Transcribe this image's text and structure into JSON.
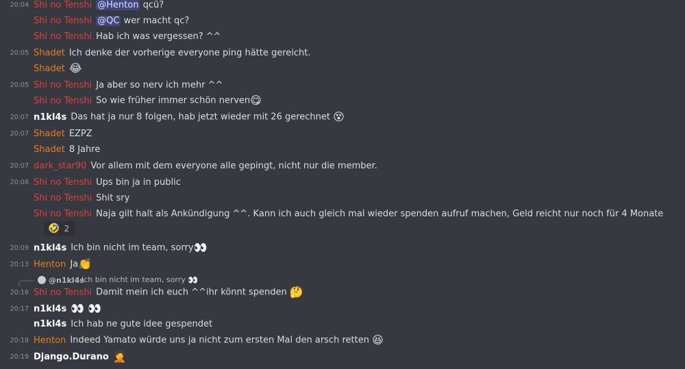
{
  "colors": {
    "background": "#36393f",
    "shi_no_tenshi": "#e0403a",
    "shadet": "#e67e22",
    "henton": "#e67e22",
    "dark_star90": "#d6453d",
    "white_user": "#ffffff",
    "timestamp": "#8e9297"
  },
  "messages": [
    {
      "time": "20:04",
      "author": "Shi no Tenshi",
      "mention": "@Henton",
      "text": "qcü?"
    },
    {
      "time": "",
      "author": "Shi no Tenshi",
      "mention": "@QC",
      "text": "wer macht qc?"
    },
    {
      "time": "",
      "author": "Shi no Tenshi",
      "text": "Hab ich was vergessen? ^^"
    },
    {
      "time": "20:05",
      "author": "Shadet",
      "text": "Ich denke der vorherige everyone ping hätte gereicht."
    },
    {
      "time": "",
      "author": "Shadet",
      "emoji": "😂"
    },
    {
      "time": "20:05",
      "author": "Shi no Tenshi",
      "text": "Ja aber so nerv ich mehr ^^"
    },
    {
      "time": "",
      "author": "Shi no Tenshi",
      "text": "So wie früher immer schön nerven",
      "emoji": "😋"
    },
    {
      "time": "20:07",
      "author": "n1kl4s",
      "text": "Das hat ja nur 8 folgen, hab jetzt wieder mit 26 gerechnet",
      "emoji": "😵"
    },
    {
      "time": "20:07",
      "author": "Shadet",
      "text": "EZPZ"
    },
    {
      "time": "",
      "author": "Shadet",
      "text": "8 Jahre"
    },
    {
      "time": "20:07",
      "author": "dark_star90",
      "text": "Vor allem mit dem everyone alle gepingt, nicht nur die member."
    },
    {
      "time": "20:08",
      "author": "Shi no Tenshi",
      "text": "Ups bin ja in public"
    },
    {
      "time": "",
      "author": "Shi no Tenshi",
      "text": "Shit sry"
    },
    {
      "time": "",
      "author": "Shi no Tenshi",
      "text": "Naja gilt halt als Ankündigung ^^. Kann ich auch gleich mal wieder spenden aufruf machen, Geld reicht nur noch für 4 Monate"
    },
    {
      "time": "20:09",
      "author": "n1kl4s",
      "text": "Ich bin nicht im team, sorry",
      "emoji": "👀"
    },
    {
      "time": "20:13",
      "author": "Henton",
      "text": "Ja",
      "emoji": "👏"
    },
    {
      "time": "20:16",
      "author": "Shi no Tenshi",
      "text": "Damit mein ich euch ^^ihr könnt spenden",
      "emoji": "🤔"
    },
    {
      "time": "20:17",
      "author": "n1kl4s",
      "emoji": "👀 👀"
    },
    {
      "time": "",
      "author": "n1kl4s",
      "text": "Ich hab ne gute idee gespendet"
    },
    {
      "time": "20:18",
      "author": "Henton",
      "text": "Indeed Yamato würde uns ja nicht zum ersten Mal den arsch retten",
      "emoji": "😆"
    },
    {
      "time": "20:19",
      "author": "Django.Durano",
      "emoji": "🤦"
    }
  ],
  "reaction": {
    "emoji": "🤣",
    "count": "2"
  },
  "reply": {
    "author": "@n1kl4s",
    "text": "Ich bin nicht im team, sorry",
    "emoji": "👀"
  }
}
